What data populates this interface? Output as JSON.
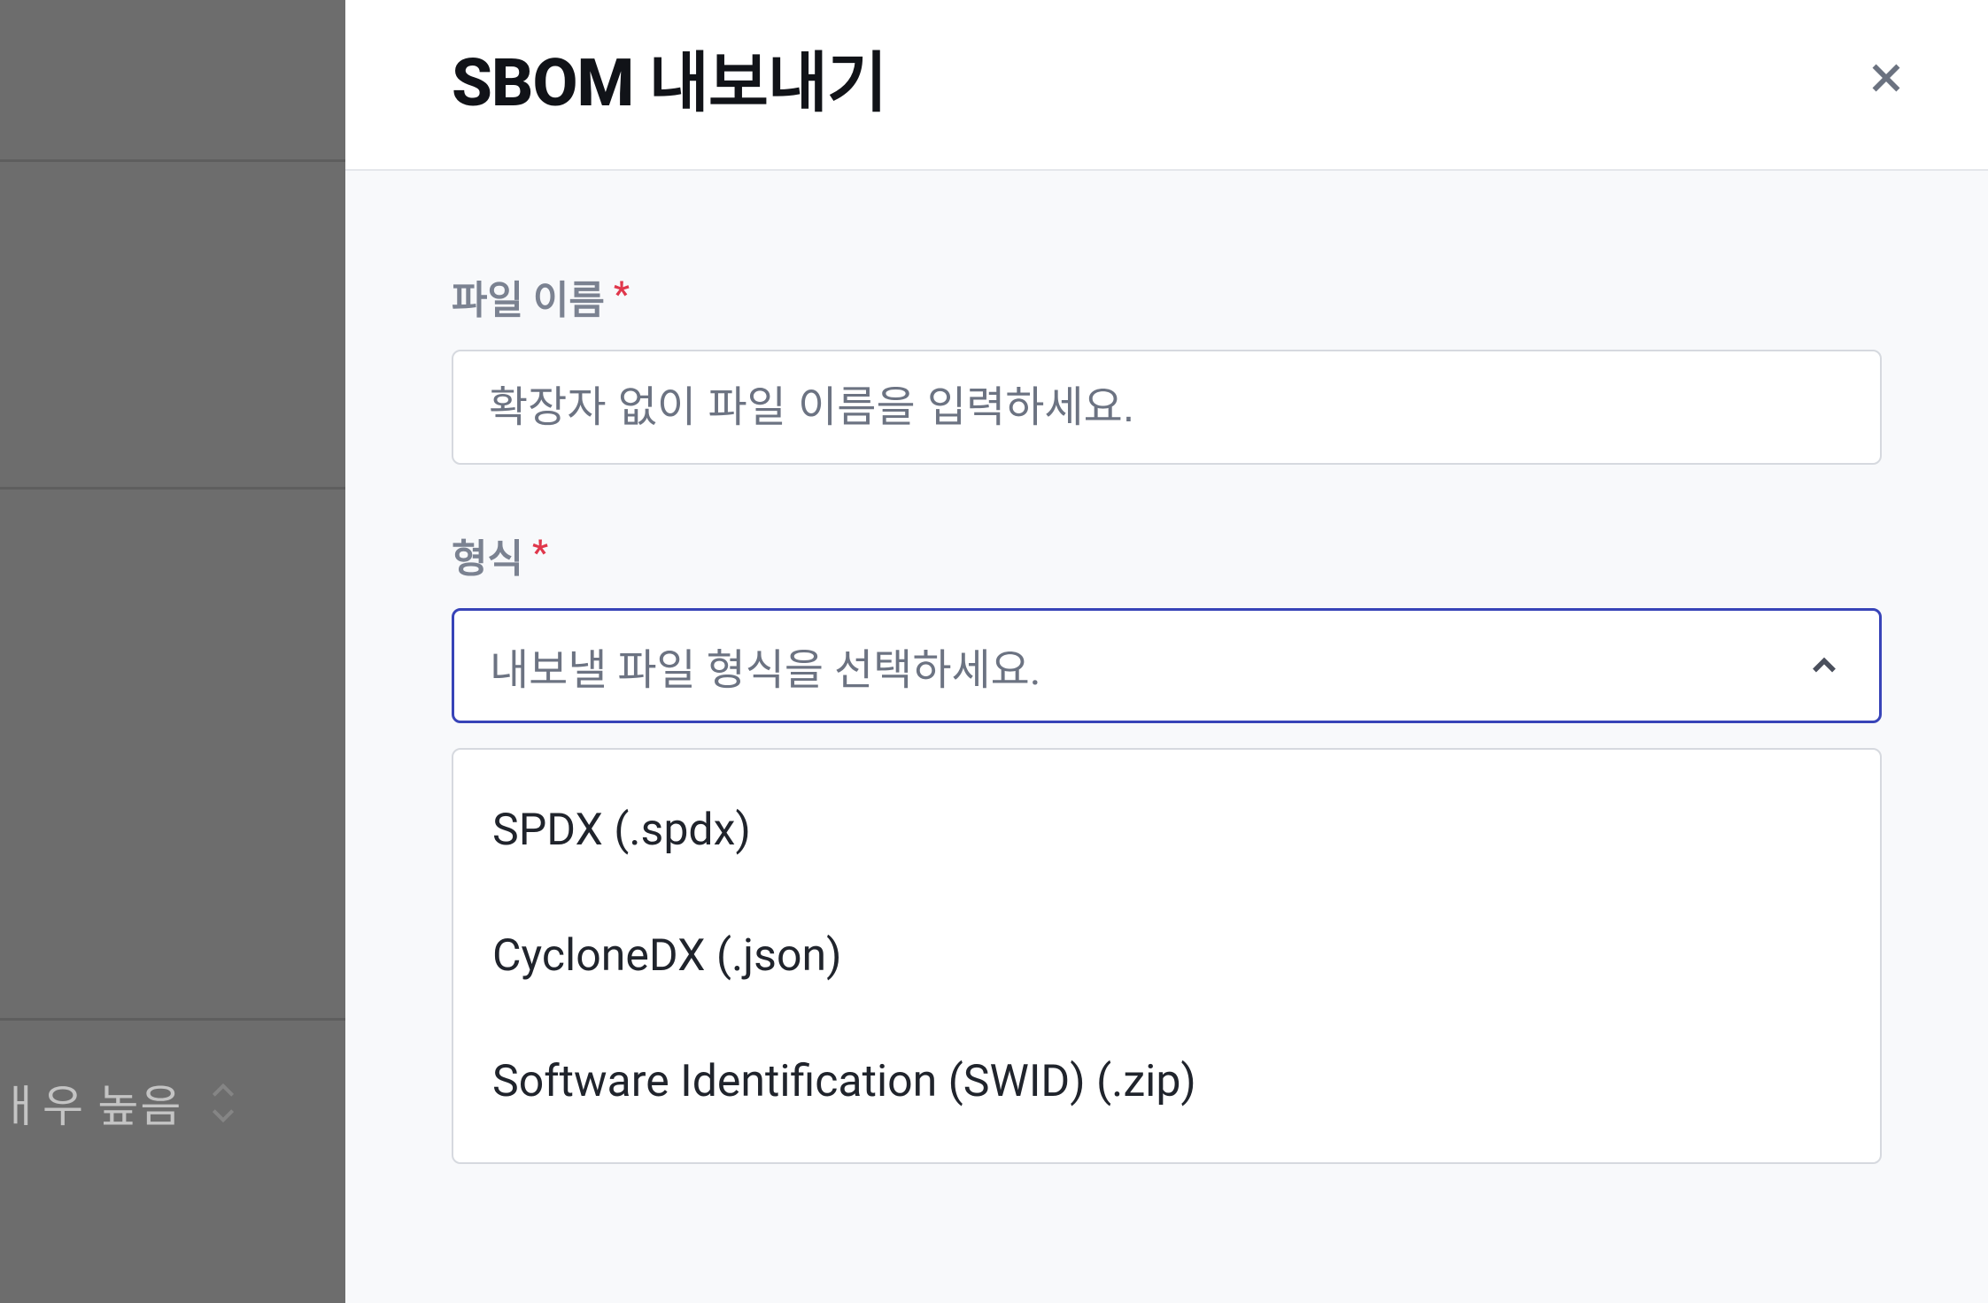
{
  "backdrop": {
    "side_label": "ㅐ우 높음"
  },
  "modal": {
    "title": "SBOM 내보내기",
    "fields": {
      "filename": {
        "label": "파일 이름",
        "placeholder": "확장자 없이 파일 이름을 입력하세요.",
        "value": ""
      },
      "format": {
        "label": "형식",
        "placeholder": "내보낼 파일 형식을 선택하세요.",
        "options": [
          "SPDX (.spdx)",
          "CycloneDX (.json)",
          "Software Identification (SWID) (.zip)"
        ]
      }
    }
  }
}
